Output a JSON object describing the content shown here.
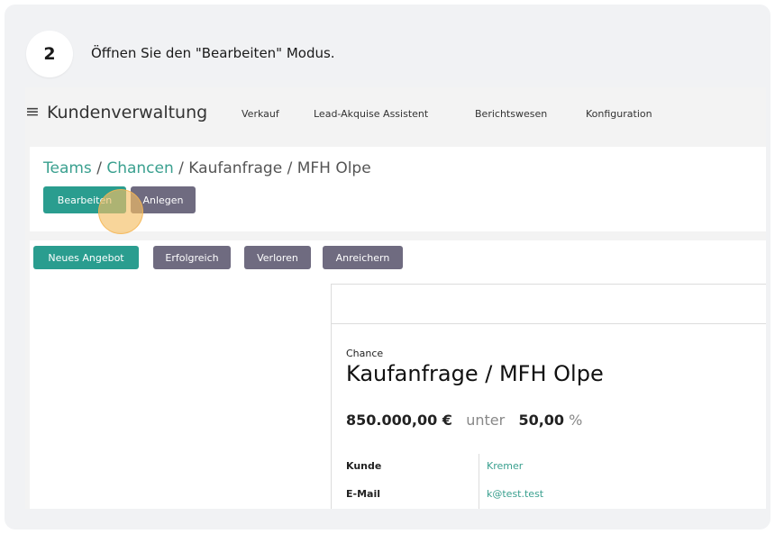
{
  "step": {
    "number": "2",
    "text": "Öffnen Sie den \"Bearbeiten\" Modus."
  },
  "app": {
    "menu_icon": "hamburger-icon",
    "title": "Kundenverwaltung",
    "nav": [
      "Verkauf",
      "Lead-Akquise Assistent",
      "Berichtswesen",
      "Konfiguration"
    ]
  },
  "breadcrumb": {
    "teams": "Teams",
    "sep1": "/",
    "chancen": "Chancen",
    "rest": "/ Kaufanfrage / MFH Olpe"
  },
  "controls": {
    "edit": "Bearbeiten",
    "create": "Anlegen"
  },
  "actions": [
    "Neues Angebot",
    "Erfolgreich",
    "Verloren",
    "Anreichern"
  ],
  "record": {
    "label": "Chance",
    "title": "Kaufanfrage / MFH Olpe",
    "amount": "850.000,00 €",
    "under": "unter",
    "prob": "50,00",
    "pct": "%",
    "fields": [
      {
        "label": "Kunde",
        "value": "Kremer"
      },
      {
        "label": "E-Mail",
        "value": "k@test.test"
      }
    ]
  },
  "colors": {
    "primary": "#2a9d8f",
    "secondary": "#6f6b80",
    "link": "#3aa08f",
    "highlight": "#f5be64"
  }
}
